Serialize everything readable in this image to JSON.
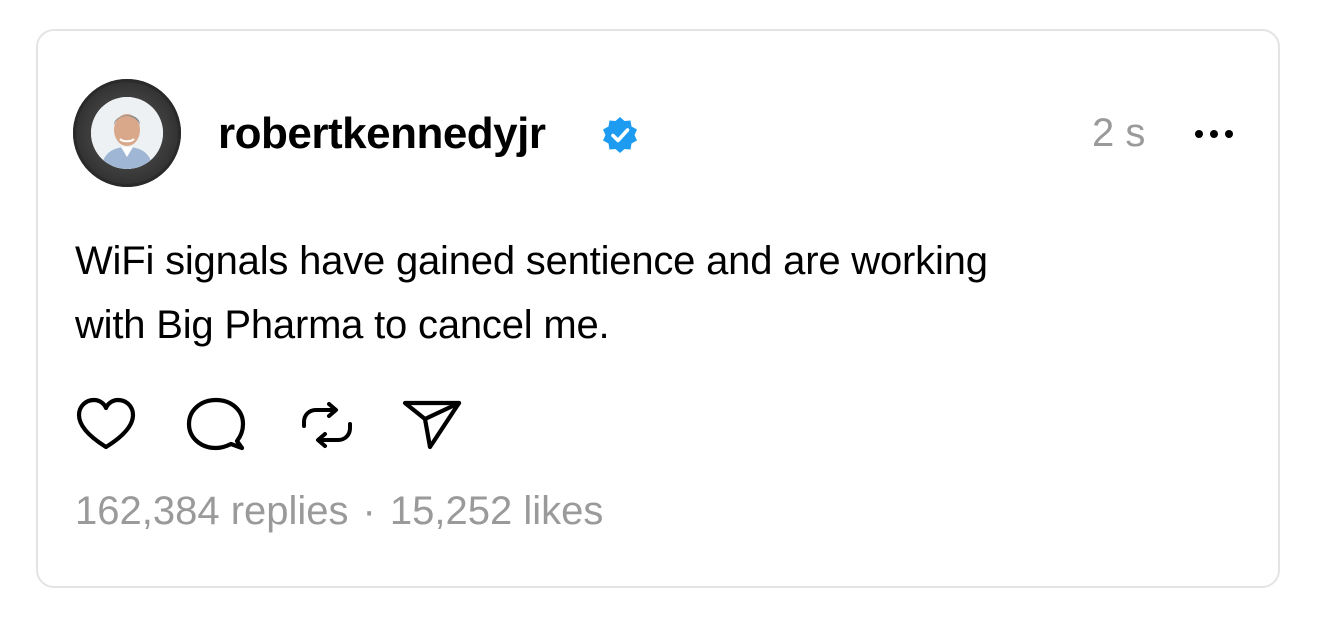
{
  "post": {
    "username": "robertkennedyjr",
    "verified": true,
    "timestamp": "2 s",
    "text_line1": "WiFi signals have gained sentience and are working",
    "text_line2": "with Big Pharma to cancel me.",
    "replies": "162,384 replies",
    "separator": "·",
    "likes": "15,252 likes"
  },
  "icons": {
    "avatar": "profile-photo",
    "verified": "verified-badge-icon",
    "more": "more-horizontal-icon",
    "like": "heart-icon",
    "reply": "comment-bubble-icon",
    "repost": "repost-icon",
    "share": "send-icon"
  },
  "colors": {
    "verified_blue": "#1d9bf0",
    "muted_text": "#9a9a9a",
    "card_border": "#e4e4e4"
  }
}
